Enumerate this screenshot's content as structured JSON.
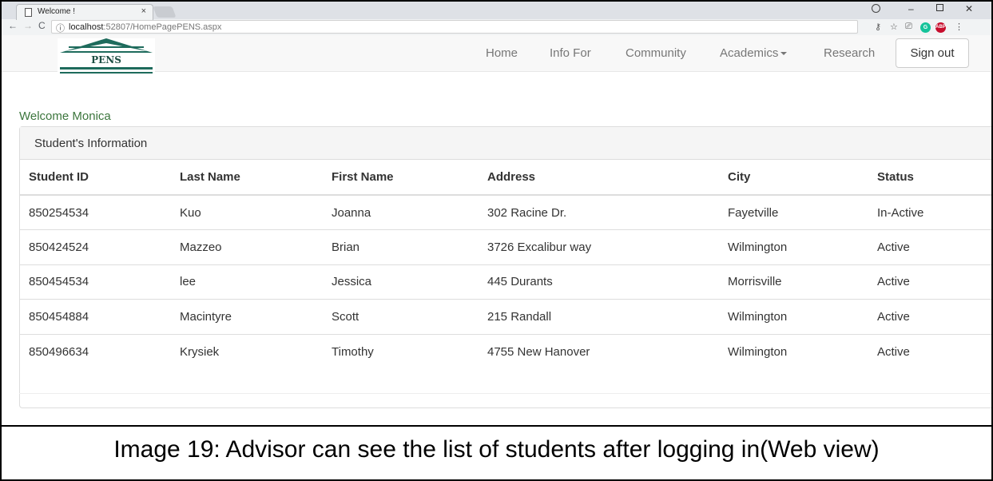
{
  "browser": {
    "tab_title": "Welcome !",
    "tab_close": "×",
    "url_host": "localhost",
    "url_path": ":52807/HomePagePENS.aspx",
    "extensions": [
      "key-icon",
      "star-icon",
      "cast-icon",
      "grammarly-icon",
      "adblock-icon"
    ],
    "adblock_label": "ABP",
    "grammarly_label": "G"
  },
  "logo": {
    "text": "PENS"
  },
  "nav": {
    "home": "Home",
    "info_for": "Info For",
    "community": "Community",
    "academics": "Academics",
    "research": "Research",
    "sign_out": "Sign out"
  },
  "welcome_text": "Welcome Monica",
  "panel": {
    "title": "Student's Information",
    "columns": [
      "Student ID",
      "Last Name",
      "First Name",
      "Address",
      "City",
      "Status"
    ],
    "rows": [
      [
        "850254534",
        "Kuo",
        "Joanna",
        "302 Racine Dr.",
        "Fayetville",
        "In-Active"
      ],
      [
        "850424524",
        "Mazzeo",
        "Brian",
        "3726 Excalibur way",
        "Wilmington",
        "Active"
      ],
      [
        "850454534",
        "lee",
        "Jessica",
        "445 Durants",
        "Morrisville",
        "Active"
      ],
      [
        "850454884",
        "Macintyre",
        "Scott",
        "215 Randall",
        "Wilmington",
        "Active"
      ],
      [
        "850496634",
        "Krysiek",
        "Timothy",
        "4755 New Hanover",
        "Wilmington",
        "Active"
      ]
    ]
  },
  "caption": "Image 19: Advisor can see the list of students after logging in(Web view)"
}
